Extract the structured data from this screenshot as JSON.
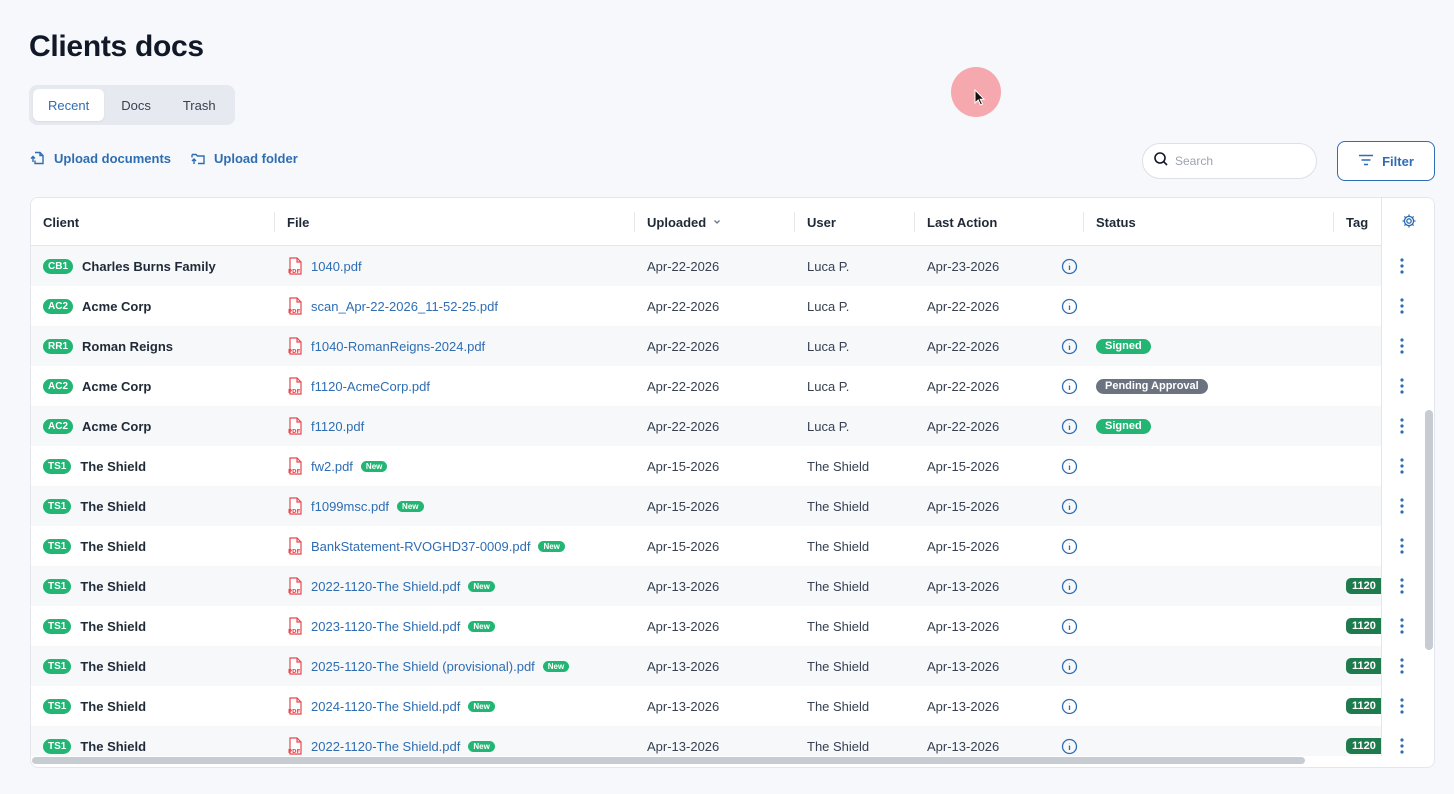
{
  "page": {
    "title": "Clients docs"
  },
  "tabs": [
    {
      "label": "Recent",
      "active": true
    },
    {
      "label": "Docs",
      "active": false
    },
    {
      "label": "Trash",
      "active": false
    }
  ],
  "actions": {
    "upload_documents": "Upload documents",
    "upload_folder": "Upload folder"
  },
  "search": {
    "placeholder": "Search",
    "value": ""
  },
  "filter": {
    "label": "Filter"
  },
  "table": {
    "columns": {
      "client": "Client",
      "file": "File",
      "uploaded": "Uploaded",
      "user": "User",
      "last_action": "Last Action",
      "status": "Status",
      "tag": "Tag"
    },
    "rows": [
      {
        "badge": "CB1",
        "client": "Charles Burns Family",
        "file": "1040.pdf",
        "new": "",
        "uploaded": "Apr-22-2026",
        "user": "Luca P.",
        "last_action": "Apr-23-2026",
        "status": "",
        "tag": ""
      },
      {
        "badge": "AC2",
        "client": "Acme Corp",
        "file": "scan_Apr-22-2026_11-52-25.pdf",
        "new": "",
        "uploaded": "Apr-22-2026",
        "user": "Luca P.",
        "last_action": "Apr-22-2026",
        "status": "",
        "tag": ""
      },
      {
        "badge": "RR1",
        "client": "Roman Reigns",
        "file": "f1040-RomanReigns-2024.pdf",
        "new": "",
        "uploaded": "Apr-22-2026",
        "user": "Luca P.",
        "last_action": "Apr-22-2026",
        "status": "Signed",
        "tag": ""
      },
      {
        "badge": "AC2",
        "client": "Acme Corp",
        "file": "f1120-AcmeCorp.pdf",
        "new": "",
        "uploaded": "Apr-22-2026",
        "user": "Luca P.",
        "last_action": "Apr-22-2026",
        "status": "Pending Approval",
        "tag": ""
      },
      {
        "badge": "AC2",
        "client": "Acme Corp",
        "file": "f1120.pdf",
        "new": "",
        "uploaded": "Apr-22-2026",
        "user": "Luca P.",
        "last_action": "Apr-22-2026",
        "status": "Signed",
        "tag": ""
      },
      {
        "badge": "TS1",
        "client": "The Shield",
        "file": "fw2.pdf",
        "new": "New",
        "uploaded": "Apr-15-2026",
        "user": "The Shield",
        "last_action": "Apr-15-2026",
        "status": "",
        "tag": ""
      },
      {
        "badge": "TS1",
        "client": "The Shield",
        "file": "f1099msc.pdf",
        "new": "New",
        "uploaded": "Apr-15-2026",
        "user": "The Shield",
        "last_action": "Apr-15-2026",
        "status": "",
        "tag": ""
      },
      {
        "badge": "TS1",
        "client": "The Shield",
        "file": "BankStatement-RVOGHD37-0009.pdf",
        "new": "New",
        "uploaded": "Apr-15-2026",
        "user": "The Shield",
        "last_action": "Apr-15-2026",
        "status": "",
        "tag": ""
      },
      {
        "badge": "TS1",
        "client": "The Shield",
        "file": "2022-1120-The Shield.pdf",
        "new": "New",
        "uploaded": "Apr-13-2026",
        "user": "The Shield",
        "last_action": "Apr-13-2026",
        "status": "",
        "tag": "1120"
      },
      {
        "badge": "TS1",
        "client": "The Shield",
        "file": "2023-1120-The Shield.pdf",
        "new": "New",
        "uploaded": "Apr-13-2026",
        "user": "The Shield",
        "last_action": "Apr-13-2026",
        "status": "",
        "tag": "1120"
      },
      {
        "badge": "TS1",
        "client": "The Shield",
        "file": "2025-1120-The Shield (provisional).pdf",
        "new": "New",
        "uploaded": "Apr-13-2026",
        "user": "The Shield",
        "last_action": "Apr-13-2026",
        "status": "",
        "tag": "1120"
      },
      {
        "badge": "TS1",
        "client": "The Shield",
        "file": "2024-1120-The Shield.pdf",
        "new": "New",
        "uploaded": "Apr-13-2026",
        "user": "The Shield",
        "last_action": "Apr-13-2026",
        "status": "",
        "tag": "1120"
      },
      {
        "badge": "TS1",
        "client": "The Shield",
        "file": "2022-1120-The Shield.pdf",
        "new": "New",
        "uploaded": "Apr-13-2026",
        "user": "The Shield",
        "last_action": "Apr-13-2026",
        "status": "",
        "tag": "1120"
      }
    ]
  },
  "colors": {
    "accent": "#2f6db3",
    "badge_green": "#22b573",
    "signed": "#22b573",
    "pending": "#6b7280",
    "tag": "#1f7a4d"
  },
  "icons": {
    "upload_documents": "upload-doc-icon",
    "upload_folder": "upload-folder-icon",
    "search": "search-icon",
    "filter": "filter-lines-icon",
    "file": "pdf-file-icon",
    "info": "info-circle-icon",
    "more": "kebab-icon",
    "settings": "gear-icon",
    "sort": "chevron-down-icon"
  }
}
